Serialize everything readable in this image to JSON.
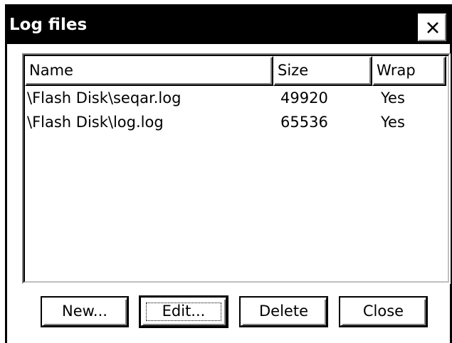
{
  "window": {
    "title": "Log files",
    "close_icon": "close-icon"
  },
  "list": {
    "columns": [
      "Name",
      "Size",
      "Wrap"
    ],
    "rows": [
      {
        "name": "\\Flash Disk\\seqar.log",
        "size": "49920",
        "wrap": "Yes"
      },
      {
        "name": "\\Flash Disk\\log.log",
        "size": "65536",
        "wrap": "Yes"
      }
    ]
  },
  "buttons": {
    "new_label": "New...",
    "edit_label": "Edit...",
    "delete_label": "Delete",
    "close_label": "Close"
  }
}
